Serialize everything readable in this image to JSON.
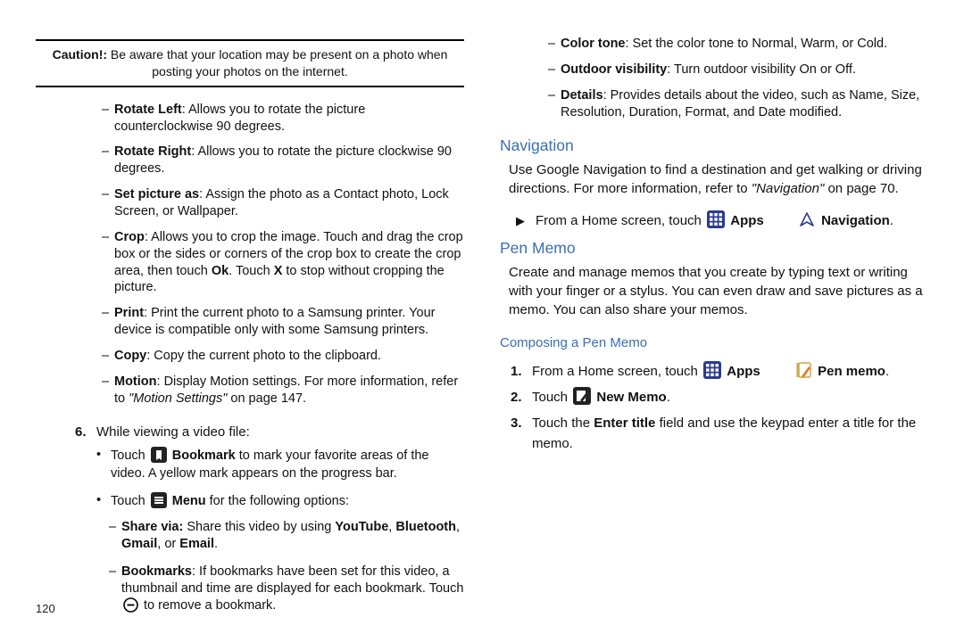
{
  "page_number": "120",
  "caution_label": "Caution!:",
  "caution_text": "Be aware that your location may be present on a photo when posting your photos on the internet.",
  "left_dashes": {
    "rotate_left_b": "Rotate Left",
    "rotate_left_t": ": Allows you to rotate the picture counterclockwise 90 degrees.",
    "rotate_right_b": "Rotate Right",
    "rotate_right_t": ": Allows you to rotate the picture clockwise 90 degrees.",
    "set_pic_b": "Set picture as",
    "set_pic_t": ": Assign the photo as a Contact photo, Lock Screen, or Wallpaper.",
    "crop_b": "Crop",
    "crop_t1": ": Allows you to crop the image. Touch and drag the crop box or the sides or corners of the crop box to create the crop area, then touch ",
    "crop_ok": "Ok",
    "crop_t2": ". Touch ",
    "crop_x": "X",
    "crop_t3": " to stop without cropping the picture.",
    "print_b": "Print",
    "print_t": ": Print the current photo to a Samsung printer. Your device is compatible only with some Samsung printers.",
    "copy_b": "Copy",
    "copy_t": ": Copy the current photo to the clipboard.",
    "motion_b": "Motion",
    "motion_t1": ": Display Motion settings. For more information, refer to ",
    "motion_ref": "\"Motion Settings\"",
    "motion_t2": " on page 147."
  },
  "step6_num": "6.",
  "step6_text": "While viewing a video file:",
  "bullets": {
    "b1_pre": "Touch ",
    "b1_bold": "Bookmark",
    "b1_post": " to mark your favorite areas of the video. A yellow mark appears on the progress bar.",
    "b2_pre": "Touch ",
    "b2_bold": "Menu",
    "b2_post": " for the following options:"
  },
  "left_dashes2": {
    "share_b": "Share via:",
    "share_t1": " Share this video by using ",
    "share_yt": "YouTube",
    "share_c": ", ",
    "share_bt": "Bluetooth",
    "share_gm": "Gmail",
    "share_or": ", or ",
    "share_em": "Email",
    "share_dot": ".",
    "bookmarks_b": "Bookmarks",
    "bookmarks_t1": ": If bookmarks have been set for this video, a thumbnail and time are displayed for each bookmark. Touch ",
    "bookmarks_t2": " to remove a bookmark."
  },
  "right_dashes": {
    "color_b": "Color tone",
    "color_t": ": Set the color tone to Normal, Warm, or Cold.",
    "out_b": "Outdoor visibility",
    "out_t": ": Turn outdoor visibility On or Off.",
    "det_b": "Details",
    "det_t": ": Provides details about the video, such as Name, Size, Resolution, Duration, Format, and Date modified."
  },
  "nav_h": "Navigation",
  "nav_p1": "Use Google Navigation to find a destination and get walking or driving directions. For more information, refer to ",
  "nav_ref": "\"Navigation\"",
  "nav_p2": " on page 70.",
  "nav_step_pre": "From a Home screen, touch ",
  "nav_apps": "Apps",
  "nav_nav": "Navigation",
  "dot": ".",
  "pen_h": "Pen Memo",
  "pen_p": "Create and manage memos that you create by typing text or writing with your finger or a stylus. You can even draw and save pictures as a memo. You can also share your memos.",
  "compose_h": "Composing a Pen Memo",
  "steps": {
    "s1_num": "1.",
    "s1_pre": "From a Home screen, touch ",
    "s1_apps": "Apps",
    "s1_pen": "Pen memo",
    "s2_num": "2.",
    "s2_pre": "Touch ",
    "s2_new": "New Memo",
    "s3_num": "3.",
    "s3_t1": "Touch the ",
    "s3_enter": "Enter title",
    "s3_t2": " field and use the keypad enter a title for the memo."
  }
}
